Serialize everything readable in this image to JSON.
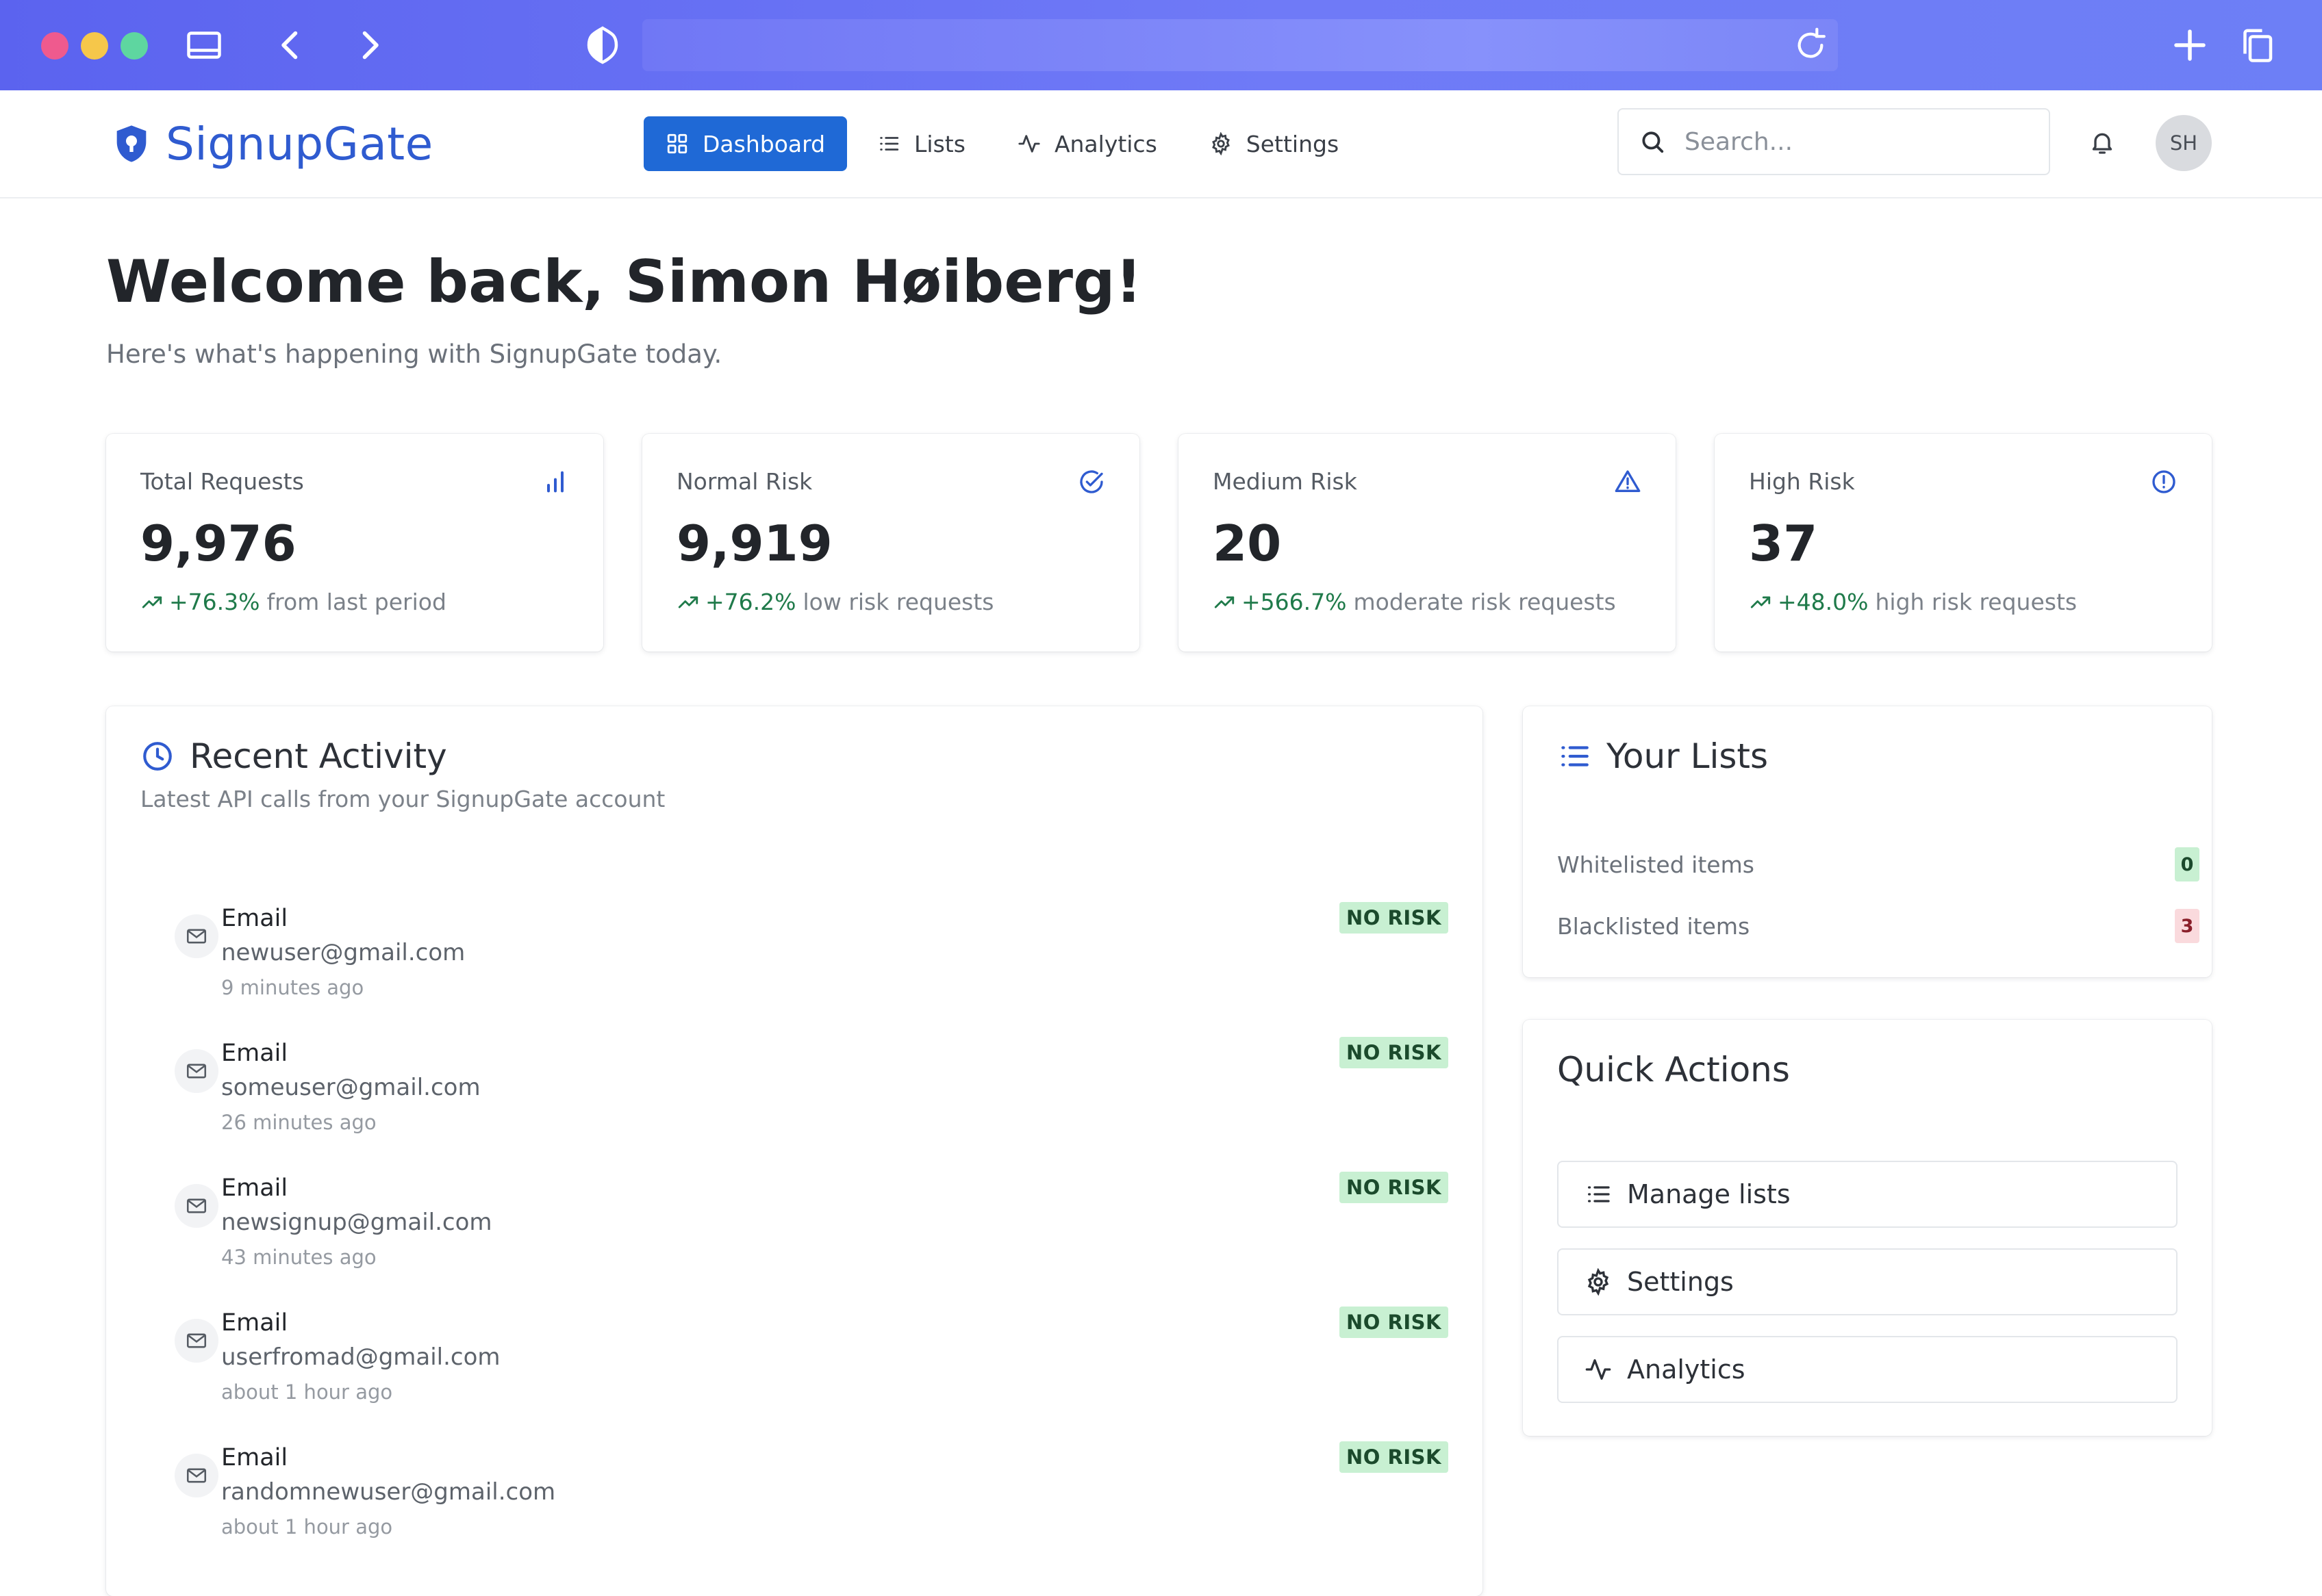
{
  "app": {
    "name": "SignupGate",
    "nav": [
      {
        "label": "Dashboard",
        "icon": "grid-icon",
        "active": true
      },
      {
        "label": "Lists",
        "icon": "list-icon",
        "active": false
      },
      {
        "label": "Analytics",
        "icon": "activity-icon",
        "active": false
      },
      {
        "label": "Settings",
        "icon": "gear-icon",
        "active": false
      }
    ],
    "search_placeholder": "Search...",
    "avatar_initials": "SH"
  },
  "welcome": {
    "title": "Welcome back, Simon Høiberg!",
    "subtitle": "Here's what's happening with SignupGate today."
  },
  "stats": [
    {
      "label": "Total Requests",
      "value": "9,976",
      "change": "+76.3%",
      "note": "from last period",
      "icon": "bar-chart-icon"
    },
    {
      "label": "Normal Risk",
      "value": "9,919",
      "change": "+76.2%",
      "note": "low risk requests",
      "icon": "check-circle-icon"
    },
    {
      "label": "Medium Risk",
      "value": "20",
      "change": "+566.7%",
      "note": "moderate risk requests",
      "icon": "alert-triangle-icon"
    },
    {
      "label": "High Risk",
      "value": "37",
      "change": "+48.0%",
      "note": "high risk requests",
      "icon": "alert-circle-icon"
    }
  ],
  "recent_activity": {
    "title": "Recent Activity",
    "description": "Latest API calls from your SignupGate account",
    "items": [
      {
        "type": "Email",
        "value": "newuser@gmail.com",
        "time": "9 minutes ago",
        "risk": "NO RISK"
      },
      {
        "type": "Email",
        "value": "someuser@gmail.com",
        "time": "26 minutes ago",
        "risk": "NO RISK"
      },
      {
        "type": "Email",
        "value": "newsignup@gmail.com",
        "time": "43 minutes ago",
        "risk": "NO RISK"
      },
      {
        "type": "Email",
        "value": "userfromad@gmail.com",
        "time": "about 1 hour ago",
        "risk": "NO RISK"
      },
      {
        "type": "Email",
        "value": "randomnewuser@gmail.com",
        "time": "about 1 hour ago",
        "risk": "NO RISK"
      }
    ]
  },
  "your_lists": {
    "title": "Your Lists",
    "items": [
      {
        "label": "Whitelisted items",
        "count": "0"
      },
      {
        "label": "Blacklisted items",
        "count": "3"
      }
    ]
  },
  "quick_actions": {
    "title": "Quick Actions",
    "buttons": [
      {
        "label": "Manage lists",
        "icon": "list-icon"
      },
      {
        "label": "Settings",
        "icon": "gear-icon"
      },
      {
        "label": "Analytics",
        "icon": "activity-icon"
      }
    ]
  },
  "colors": {
    "chrome_bar": "#5b63ef",
    "brand": "#2f5bd0",
    "primary": "#1f69d6",
    "trend_up": "#1f7a4a",
    "badge_green": "#c8f0d2",
    "badge_red": "#fadadd"
  }
}
